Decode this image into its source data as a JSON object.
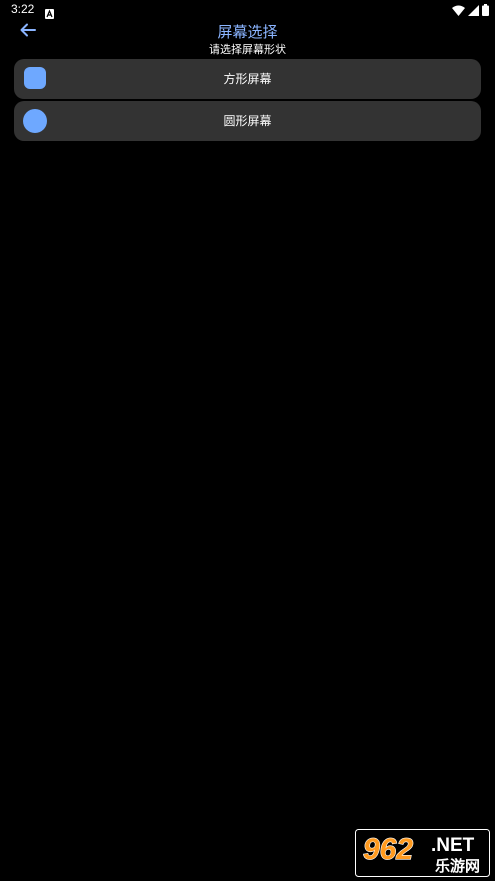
{
  "status_bar": {
    "time": "3:22",
    "icons": [
      "notification-a-icon",
      "wifi-icon",
      "cellular-icon",
      "battery-icon"
    ]
  },
  "header": {
    "back_icon": "arrow-left-icon",
    "title": "屏幕选择",
    "subtitle": "请选择屏幕形状"
  },
  "options": [
    {
      "label": "方形屏幕",
      "icon": "square-shape-icon"
    },
    {
      "label": "圆形屏幕",
      "icon": "circle-shape-icon"
    }
  ],
  "watermark": {
    "number": "962",
    "suffix": ".NET",
    "caption": "乐游网"
  },
  "colors": {
    "background": "#000000",
    "accent": "#8ab4ff",
    "shape": "#6ea8ff",
    "card": "#333333"
  }
}
